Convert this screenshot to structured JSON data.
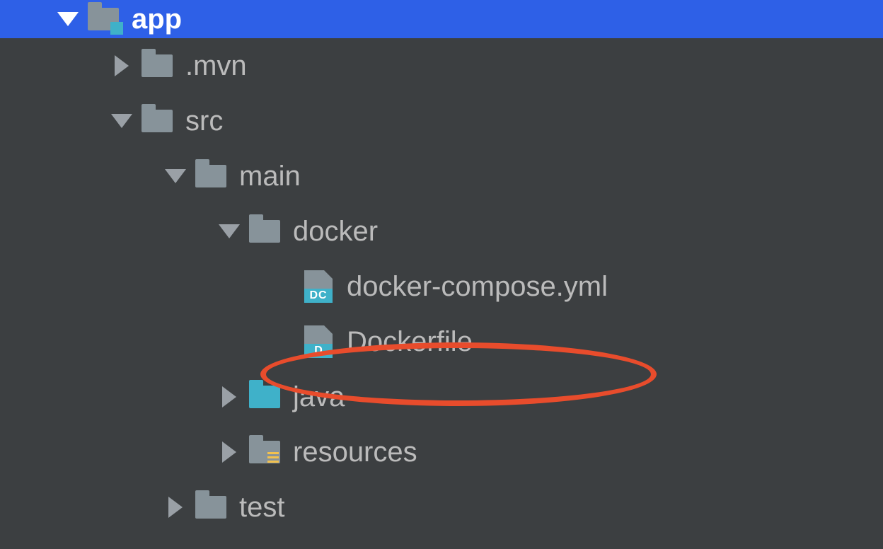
{
  "tree": {
    "app": {
      "label": "app"
    },
    "mvn": {
      "label": ".mvn"
    },
    "src": {
      "label": "src"
    },
    "main": {
      "label": "main"
    },
    "docker": {
      "label": "docker"
    },
    "docker_compose": {
      "label": "docker-compose.yml",
      "badge": "DC"
    },
    "dockerfile": {
      "label": "Dockerfile",
      "badge": "D"
    },
    "java": {
      "label": "java"
    },
    "resources": {
      "label": "resources"
    },
    "test": {
      "label": "test"
    }
  },
  "annotation": {
    "target": "dockerfile",
    "color": "#e84c2c"
  }
}
